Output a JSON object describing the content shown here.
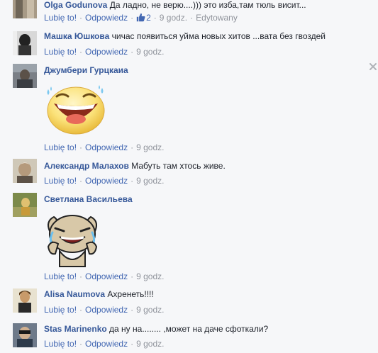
{
  "comments": [
    {
      "author": "Olga Godunova",
      "text": "Да ладно, не верю....))) это изба,там тюль висит...",
      "like": "Lubię to!",
      "reply": "Odpowiedz",
      "likes_count": "2",
      "time": "9 godz.",
      "edited": "Edytowany"
    },
    {
      "author": "Машка Юшкова",
      "text": "чичас появиться уйма новых хитов ...вата без гвоздей",
      "like": "Lubię to!",
      "reply": "Odpowiedz",
      "time": "9 godz."
    },
    {
      "author": "Джумбери Гурцкаиа",
      "text": "",
      "sticker": "laughing-face-sticker",
      "like": "Lubię to!",
      "reply": "Odpowiedz",
      "time": "9 godz."
    },
    {
      "author": "Александр Малахов",
      "text": "Мабуть там хтось живе.",
      "like": "Lubię to!",
      "reply": "Odpowiedz",
      "time": "9 godz."
    },
    {
      "author": "Светлана Васильева",
      "text": "",
      "sticker": "crying-laughing-rabbit-sticker",
      "like": "Lubię to!",
      "reply": "Odpowiedz",
      "time": "9 godz."
    },
    {
      "author": "Alisa Naumova",
      "text": "Ахренеть!!!!",
      "like": "Lubię to!",
      "reply": "Odpowiedz",
      "time": "9 godz."
    },
    {
      "author": "Stas Marinenko",
      "text": "да ну на........ ,может на даче сфоткали?",
      "like": "Lubię to!",
      "reply": "Odpowiedz",
      "time": "9 godz."
    }
  ],
  "colors": {
    "author_link": "#365899",
    "action_link": "#4267b2",
    "meta_gray": "#90949c",
    "background": "#f6f7f9"
  }
}
